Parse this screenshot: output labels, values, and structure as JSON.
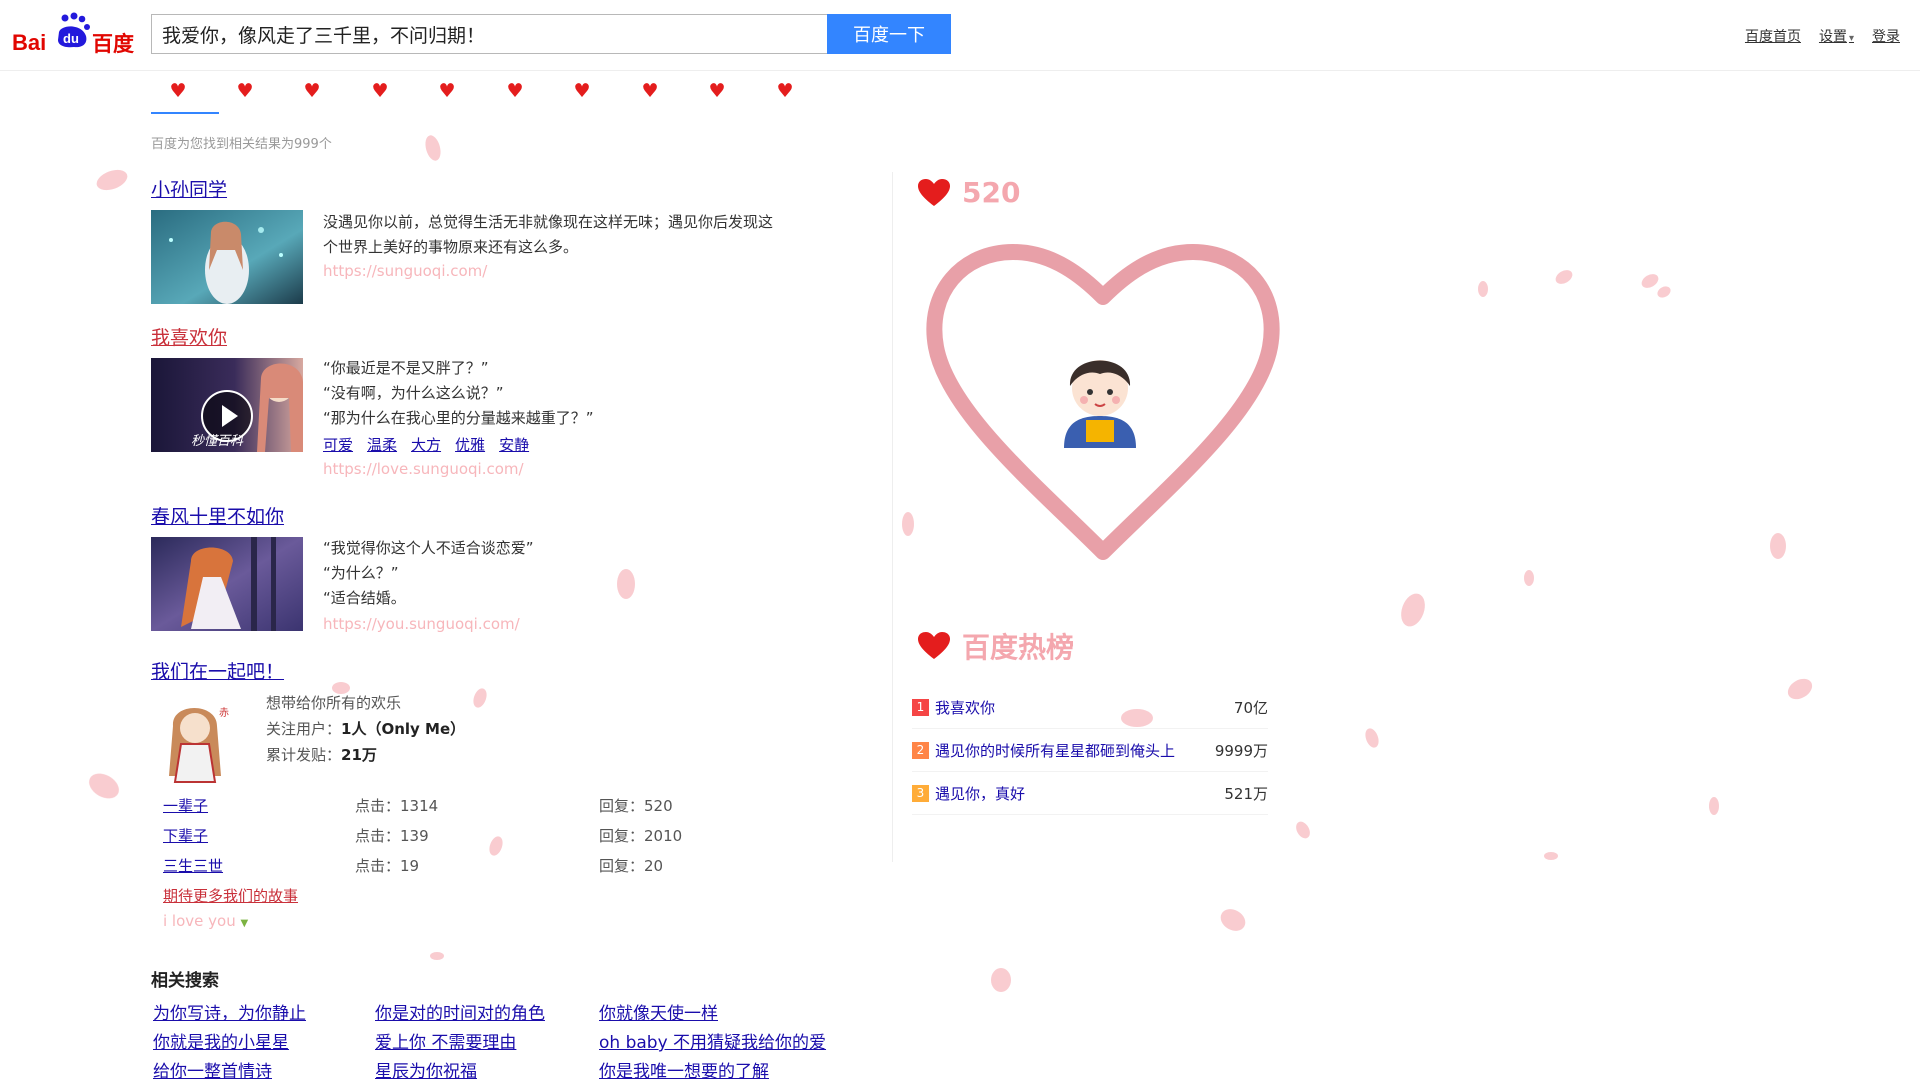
{
  "header": {
    "logo": {
      "bai": "Bai",
      "du": "du",
      "cn": "百度"
    },
    "search_value": "我爱你，像风走了三千里，不问归期！",
    "search_button": "百度一下",
    "links": {
      "home": "百度首页",
      "settings": "设置",
      "login": "登录"
    }
  },
  "tabs": [
    "♥",
    "♥",
    "♥",
    "♥",
    "♥",
    "♥",
    "♥",
    "♥",
    "♥",
    "♥"
  ],
  "result_count": "百度为您找到相关结果为999个",
  "results": {
    "r1": {
      "title": "小孙同学",
      "snippet_1": "没遇见你以前，总觉得生活无非就像现在这样无味；遇见你后发现这",
      "snippet_2": "个世界上美好的事物原来还有这么多。",
      "url": "https://sunguoqi.com/"
    },
    "r2": {
      "title": "我喜欢你",
      "watermark": "秒懂百科",
      "line_1": "“你最近是不是又胖了？”",
      "line_2": "“没有啊，为什么这么说？”",
      "line_3": "“那为什么在我心里的分量越来越重了？”",
      "tags": [
        "可爱",
        "温柔",
        "大方",
        "优雅",
        "安静"
      ],
      "url": "https://love.sunguoqi.com/"
    },
    "r3": {
      "title": "春风十里不如你",
      "line_1": "“我觉得你这个人不适合谈恋爱”",
      "line_2": "“为什么？”",
      "line_3": "“适合结婚。",
      "url": "https://you.sunguoqi.com/"
    },
    "r4": {
      "title": "我们在一起吧！",
      "desc": "想带给你所有的欢乐",
      "followers_label": "关注用户：",
      "followers_value": "1人（Only Me）",
      "posts_label": "累计发贴：",
      "posts_value": "21万",
      "threads": [
        {
          "name": "一辈子",
          "clicks": "点击：1314",
          "replies": "回复：520"
        },
        {
          "name": "下辈子",
          "clicks": "点击：139",
          "replies": "回复：2010"
        },
        {
          "name": "三生三世",
          "clicks": "点击：19",
          "replies": "回复：20"
        }
      ],
      "more": "期待更多我们的故事",
      "iloveyou": "i love you"
    }
  },
  "related": {
    "title": "相关搜索",
    "items": [
      "为你写诗，为你静止",
      "你是对的时间对的角色",
      "你就像天使一样",
      "你就是我的小星星",
      "爱上你 不需要理由",
      "oh baby 不用猜疑我给你的爱",
      "给你一整首情诗",
      "星辰为你祝福",
      "你是我唯一想要的了解"
    ]
  },
  "sidebar": {
    "love_count": "520",
    "hot_title": "百度热榜",
    "hot_list": [
      {
        "rank": "1",
        "title": "我喜欢你",
        "heat": "70亿",
        "color": "#f54545"
      },
      {
        "rank": "2",
        "title": "遇见你的时候所有星星都砸到俺头上",
        "heat": "9999万",
        "color": "#ff8547"
      },
      {
        "rank": "3",
        "title": "遇见你，真好",
        "heat": "521万",
        "color": "#ffac38"
      }
    ]
  },
  "colors": {
    "accent": "#3385ff",
    "heart": "#e41d1d",
    "pink": "#f4a7ae"
  }
}
